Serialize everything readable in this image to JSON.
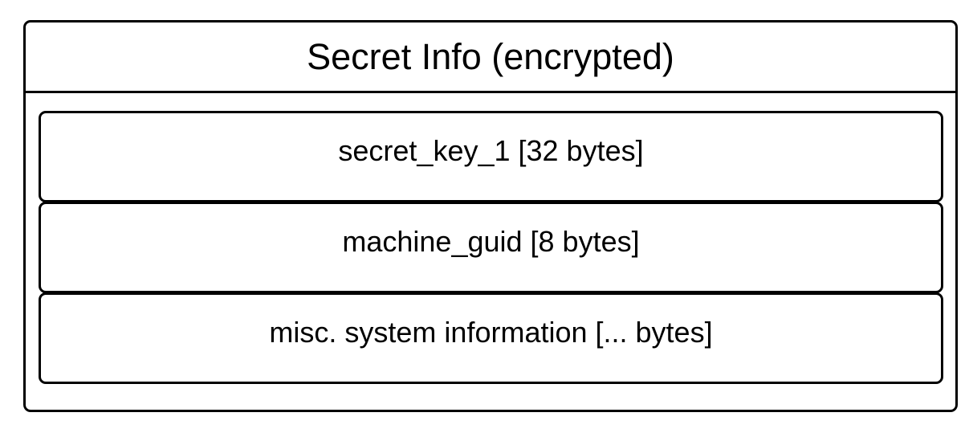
{
  "struct": {
    "title": "Secret Info (encrypted)",
    "fields": [
      {
        "label": "secret_key_1 [32 bytes]"
      },
      {
        "label": "machine_guid [8 bytes]"
      },
      {
        "label": "misc. system information [... bytes]"
      }
    ]
  },
  "colors": {
    "stroke": "#000000",
    "background": "#ffffff",
    "text": "#000000"
  }
}
